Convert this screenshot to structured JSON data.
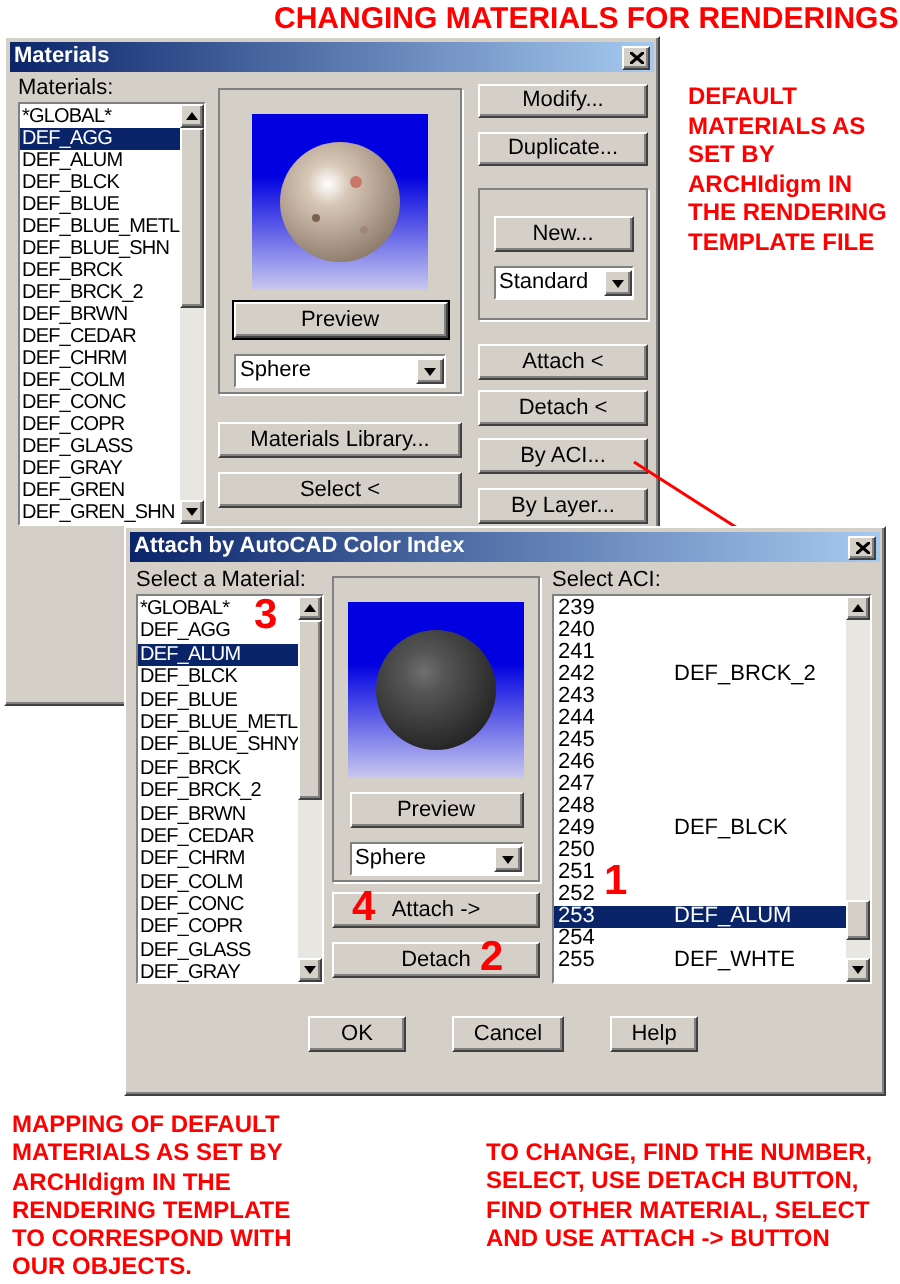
{
  "heading": "CHANGING MATERIALS FOR RENDERINGS",
  "materials_dialog": {
    "title": "Materials",
    "list_label": "Materials:",
    "items": [
      {
        "label": "*GLOBAL*",
        "selected": false
      },
      {
        "label": "DEF_AGG",
        "selected": true
      },
      {
        "label": "DEF_ALUM",
        "selected": false
      },
      {
        "label": "DEF_BLCK",
        "selected": false
      },
      {
        "label": "DEF_BLUE",
        "selected": false
      },
      {
        "label": "DEF_BLUE_METL",
        "selected": false
      },
      {
        "label": "DEF_BLUE_SHN",
        "selected": false
      },
      {
        "label": "DEF_BRCK",
        "selected": false
      },
      {
        "label": "DEF_BRCK_2",
        "selected": false
      },
      {
        "label": "DEF_BRWN",
        "selected": false
      },
      {
        "label": "DEF_CEDAR",
        "selected": false
      },
      {
        "label": "DEF_CHRM",
        "selected": false
      },
      {
        "label": "DEF_COLM",
        "selected": false
      },
      {
        "label": "DEF_CONC",
        "selected": false
      },
      {
        "label": "DEF_COPR",
        "selected": false
      },
      {
        "label": "DEF_GLASS",
        "selected": false
      },
      {
        "label": "DEF_GRAY",
        "selected": false
      },
      {
        "label": "DEF_GREN",
        "selected": false
      },
      {
        "label": "DEF_GREN_SHN",
        "selected": false
      }
    ],
    "preview_button": "Preview",
    "shape": "Sphere",
    "library_button": "Materials Library...",
    "select_button": "Select <",
    "modify_button": "Modify...",
    "duplicate_button": "Duplicate...",
    "new_button": "New...",
    "type": "Standard",
    "attach_button": "Attach <",
    "detach_button": "Detach <",
    "aci_button": "By ACI...",
    "layer_button": "By Layer..."
  },
  "default_note": "DEFAULT MATERIALS AS SET BY ARCHIdigm IN THE RENDERING TEMPLATE FILE",
  "aci_dialog": {
    "title": "Attach by AutoCAD Color Index",
    "list_label": "Select a Material:",
    "items": [
      {
        "label": "*GLOBAL*",
        "selected": false
      },
      {
        "label": "DEF_AGG",
        "selected": false
      },
      {
        "label": "DEF_ALUM",
        "selected": true
      },
      {
        "label": "DEF_BLCK",
        "selected": false
      },
      {
        "label": "DEF_BLUE",
        "selected": false
      },
      {
        "label": "DEF_BLUE_METL",
        "selected": false
      },
      {
        "label": "DEF_BLUE_SHNY",
        "selected": false
      },
      {
        "label": "DEF_BRCK",
        "selected": false
      },
      {
        "label": "DEF_BRCK_2",
        "selected": false
      },
      {
        "label": "DEF_BRWN",
        "selected": false
      },
      {
        "label": "DEF_CEDAR",
        "selected": false
      },
      {
        "label": "DEF_CHRM",
        "selected": false
      },
      {
        "label": "DEF_COLM",
        "selected": false
      },
      {
        "label": "DEF_CONC",
        "selected": false
      },
      {
        "label": "DEF_COPR",
        "selected": false
      },
      {
        "label": "DEF_GLASS",
        "selected": false
      },
      {
        "label": "DEF_GRAY",
        "selected": false
      }
    ],
    "preview_button": "Preview",
    "shape": "Sphere",
    "attach_button": "Attach ->",
    "detach_button": "Detach",
    "aci_label": "Select ACI:",
    "aci_rows": [
      {
        "number": "239",
        "selected": false
      },
      {
        "number": "240",
        "selected": false
      },
      {
        "number": "241",
        "selected": false
      },
      {
        "number": "242",
        "material": "DEF_BRCK_2",
        "selected": false
      },
      {
        "number": "243",
        "selected": false
      },
      {
        "number": "244",
        "selected": false
      },
      {
        "number": "245",
        "selected": false
      },
      {
        "number": "246",
        "selected": false
      },
      {
        "number": "247",
        "selected": false
      },
      {
        "number": "248",
        "selected": false
      },
      {
        "number": "249",
        "material": "DEF_BLCK",
        "selected": false
      },
      {
        "number": "250",
        "selected": false
      },
      {
        "number": "251",
        "selected": false
      },
      {
        "number": "252",
        "selected": false
      },
      {
        "number": "253",
        "material": "DEF_ALUM",
        "selected": true
      },
      {
        "number": "254",
        "selected": false
      },
      {
        "number": "255",
        "material": "DEF_WHTE",
        "selected": false
      }
    ],
    "ok_button": "OK",
    "cancel_button": "Cancel",
    "help_button": "Help"
  },
  "step_numbers": [
    "3",
    "1",
    "4",
    "2"
  ],
  "mapping_note": "MAPPING OF DEFAULT MATERIALS AS SET BY ARCHIdigm IN THE RENDERING TEMPLATE TO CORRESPOND WITH OUR OBJECTS.",
  "change_note": "TO CHANGE, FIND THE NUMBER, SELECT, USE DETACH BUTTON, FIND OTHER MATERIAL, SELECT AND USE ATTACH -> BUTTON"
}
